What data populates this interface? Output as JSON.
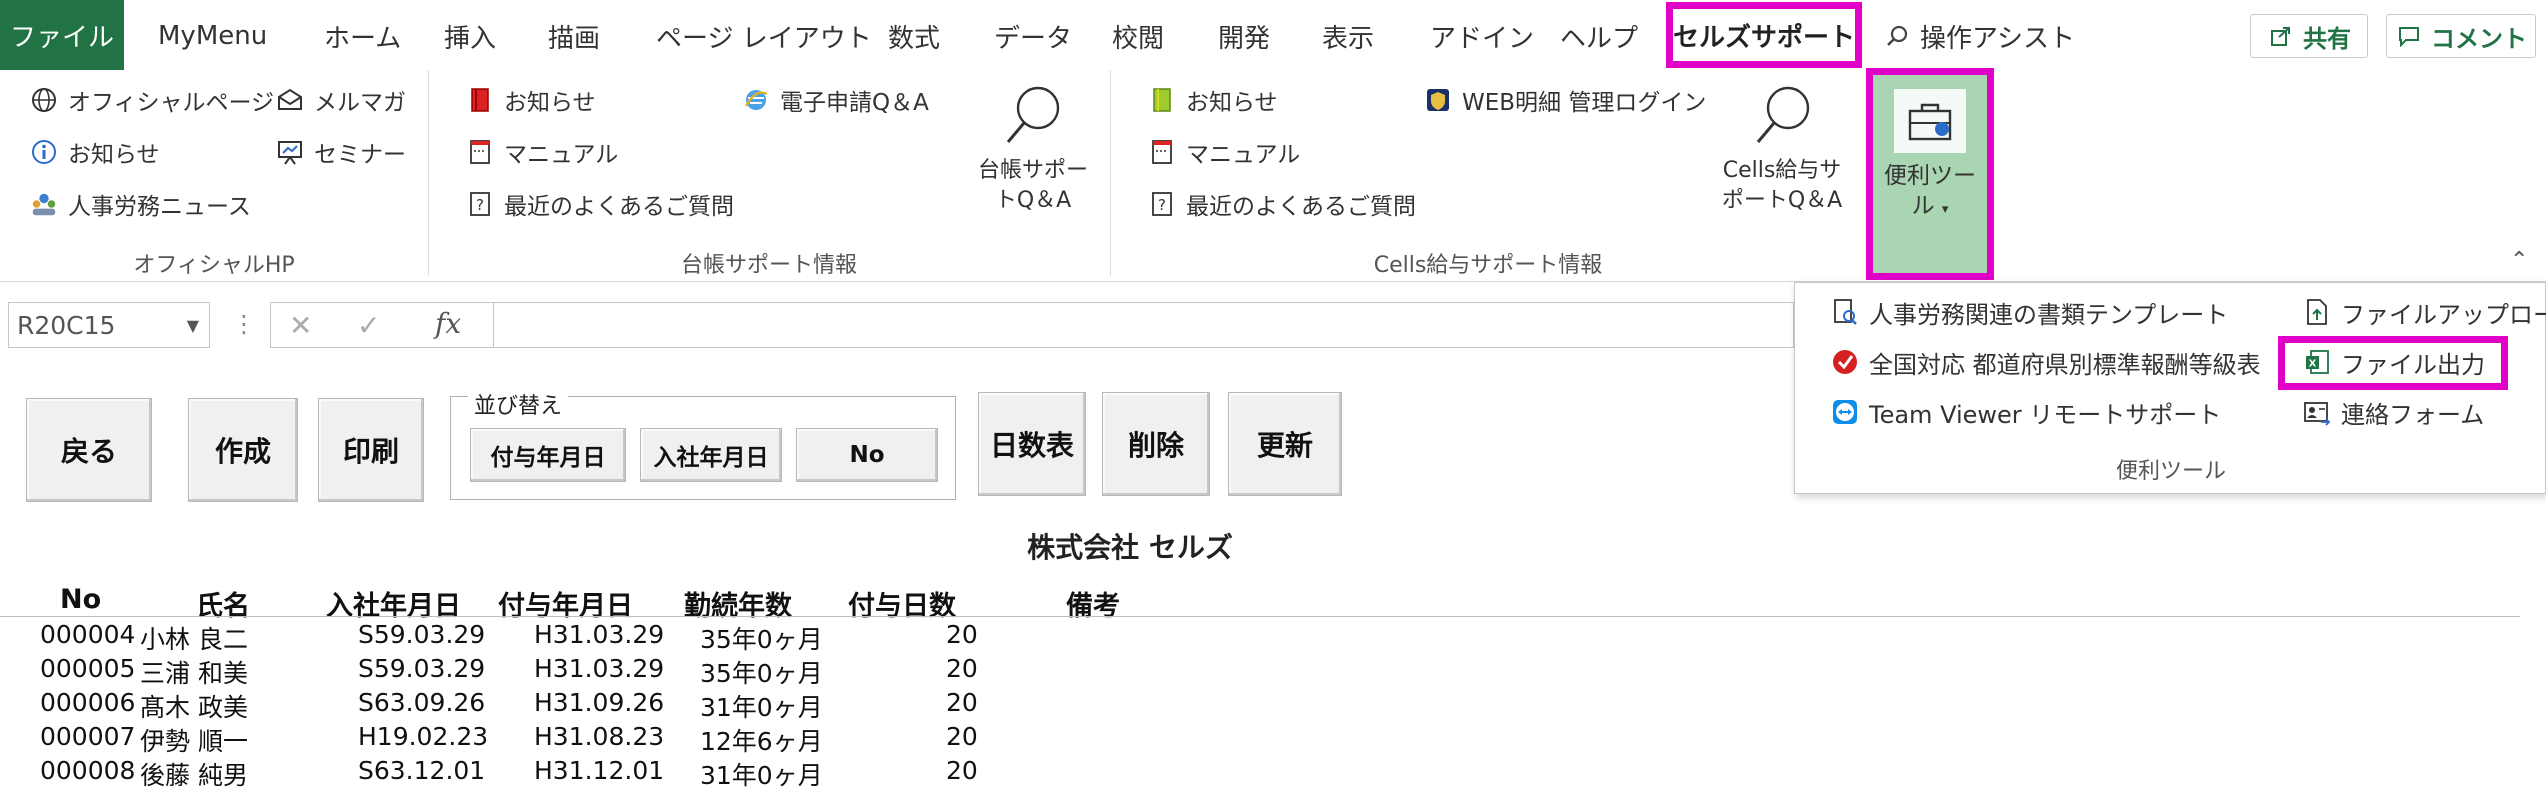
{
  "tabs": {
    "file": "ファイル",
    "items": [
      "MyMenu",
      "ホーム",
      "挿入",
      "描画",
      "ページ レイアウト",
      "数式",
      "データ",
      "校閲",
      "開発",
      "表示",
      "アドイン",
      "ヘルプ"
    ],
    "active": "セルズサポート",
    "tell_me": "操作アシスト",
    "share": "共有",
    "comment": "コメント"
  },
  "ribbon": {
    "official": {
      "items": [
        "オフィシャルページ",
        "お知らせ",
        "人事労務ニュース",
        "メルマガ",
        "セミナー"
      ],
      "label": "オフィシャルHP"
    },
    "daicho": {
      "items": [
        "お知らせ",
        "マニュアル",
        "最近のよくあるご質問",
        "電子申請Q＆A"
      ],
      "big_button": [
        "台帳サポー",
        "トQ＆A"
      ],
      "label": "台帳サポート情報"
    },
    "cells": {
      "items": [
        "お知らせ",
        "マニュアル",
        "最近のよくあるご質問",
        "WEB明細 管理ログイン"
      ],
      "big_button": [
        "Cells給与サ",
        "ポートQ＆A"
      ],
      "label": "Cells給与サポート情報"
    },
    "benri": {
      "label_line1": "便利ツー",
      "label_line2": "ル"
    }
  },
  "formula_bar": {
    "name_box": "R20C15",
    "fx": "fx",
    "value": ""
  },
  "dropdown": {
    "left_items": [
      "人事労務関連の書類テンプレート",
      "全国対応 都道府県別標準報酬等級表",
      "Team Viewer リモートサポート"
    ],
    "right_items": [
      "ファイルアップロード",
      "ファイル出力",
      "連絡フォーム"
    ],
    "group_label": "便利ツール"
  },
  "sheet": {
    "buttons": {
      "back": "戻る",
      "create": "作成",
      "print": "印刷",
      "days_table": "日数表",
      "delete": "削除",
      "update": "更新"
    },
    "sort": {
      "legend": "並び替え",
      "buttons": [
        "付与年月日",
        "入社年月日",
        "No"
      ]
    },
    "company": "株式会社 セルズ",
    "columns": [
      "No",
      "氏名",
      "入社年月日",
      "付与年月日",
      "勤続年数",
      "付与日数",
      "備考"
    ],
    "rows": [
      [
        "000004",
        "小林 良二",
        "S59.03.29",
        "H31.03.29",
        "35年0ヶ月",
        "20",
        ""
      ],
      [
        "000005",
        "三浦 和美",
        "S59.03.29",
        "H31.03.29",
        "35年0ヶ月",
        "20",
        ""
      ],
      [
        "000006",
        "髙木 政美",
        "S63.09.26",
        "H31.09.26",
        "31年0ヶ月",
        "20",
        ""
      ],
      [
        "000007",
        "伊勢 順一",
        "H19.02.23",
        "H31.08.23",
        "12年6ヶ月",
        "20",
        ""
      ],
      [
        "000008",
        "後藤 純男",
        "S63.12.01",
        "H31.12.01",
        "31年0ヶ月",
        "20",
        ""
      ]
    ]
  },
  "colors": {
    "file_tab": "#217346",
    "highlight": "#e100c8",
    "benri_bg": "#a9d5b3"
  }
}
